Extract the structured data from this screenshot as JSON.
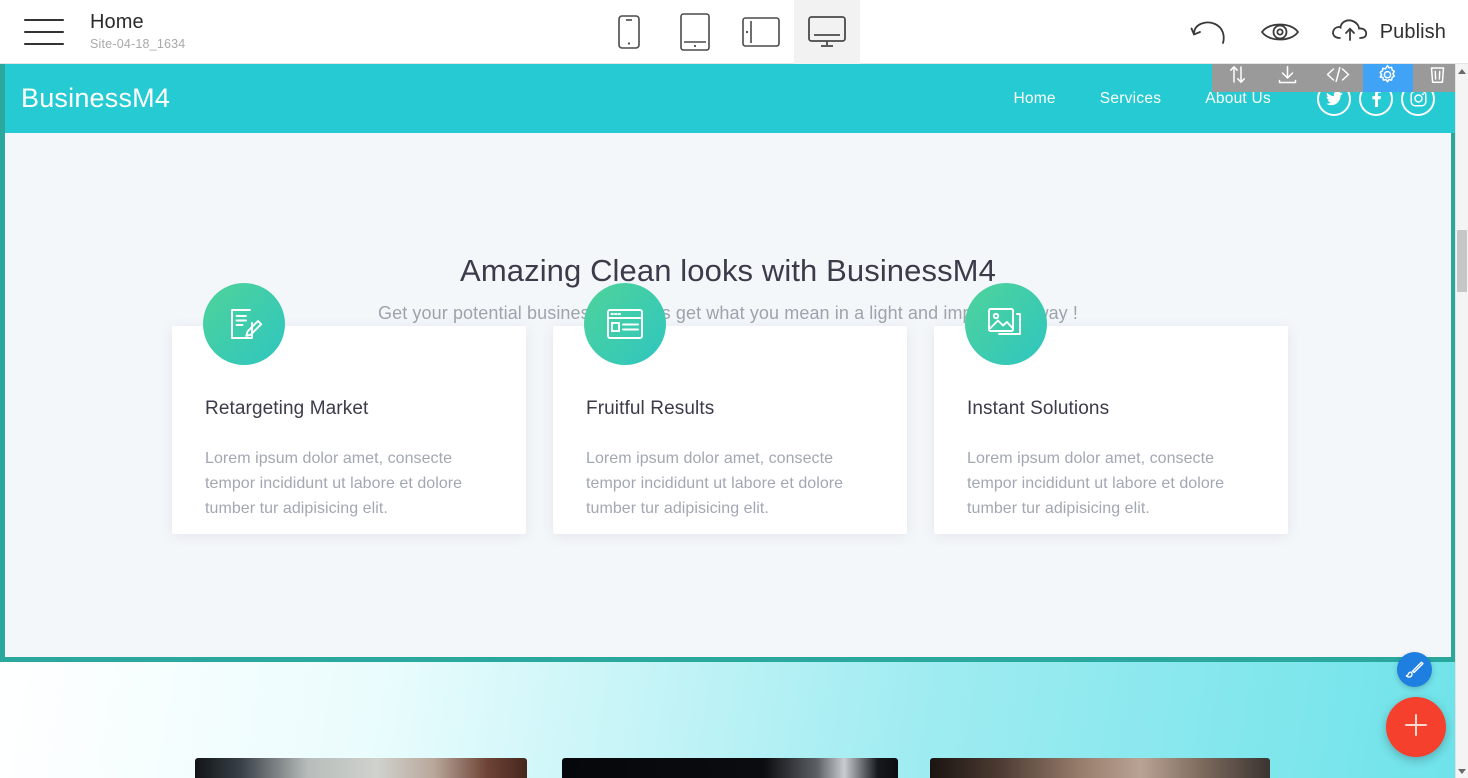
{
  "app_bar": {
    "menu_icon": "hamburger-icon",
    "page_title": "Home",
    "site_id": "Site-04-18_1634",
    "devices": [
      {
        "name": "mobile",
        "icon": "mobile-phone-icon",
        "active": false
      },
      {
        "name": "tablet-portrait",
        "icon": "tablet-portrait-icon",
        "active": false
      },
      {
        "name": "tablet-landscape",
        "icon": "tablet-landscape-icon",
        "active": false
      },
      {
        "name": "desktop",
        "icon": "desktop-monitor-icon",
        "active": true
      }
    ],
    "undo_icon": "undo-arrow-icon",
    "preview_icon": "eye-preview-icon",
    "publish_icon": "cloud-upload-icon",
    "publish_label": "Publish"
  },
  "block_toolbar": {
    "buttons": [
      {
        "name": "move-block",
        "icon": "up-down-arrows-icon",
        "active": false
      },
      {
        "name": "save-block",
        "icon": "download-icon",
        "active": false
      },
      {
        "name": "edit-code",
        "icon": "code-brackets-icon",
        "active": false
      },
      {
        "name": "block-settings",
        "icon": "gear-icon",
        "active": true
      },
      {
        "name": "delete-block",
        "icon": "trash-icon",
        "active": false
      }
    ],
    "active_color": "#41a3f5",
    "bar_color": "#9a9a9a"
  },
  "site": {
    "header": {
      "brand": "BusinessM4",
      "background": "#25cad2",
      "nav": [
        {
          "label": "Home"
        },
        {
          "label": "Services"
        },
        {
          "label": "About Us"
        }
      ],
      "social": [
        {
          "name": "twitter-icon"
        },
        {
          "name": "facebook-icon"
        },
        {
          "name": "instagram-icon"
        }
      ]
    },
    "hero": {
      "title": "Amazing Clean looks with BusinessM4",
      "subtitle": "Get your potential business partners get what you mean in a light and impressive way !",
      "background": "#f4f7fa"
    },
    "cards": [
      {
        "icon": "document-pencil-icon",
        "title": "Retargeting Market",
        "text": "Lorem ipsum dolor amet, consecte tempor incididunt ut labore et dolore tumber tur adipisicing elit."
      },
      {
        "icon": "browser-window-icon",
        "title": "Fruitful Results",
        "text": "Lorem ipsum dolor amet, consecte tempor incididunt ut labore et dolore tumber tur adipisicing elit."
      },
      {
        "icon": "photo-gallery-icon",
        "title": "Instant Solutions",
        "text": "Lorem ipsum dolor amet, consecte tempor incididunt ut labore et dolore tumber tur adipisicing elit."
      }
    ],
    "selection_border_color": "#2aa89d"
  },
  "fabs": {
    "design": {
      "name": "paintbrush-icon",
      "color": "#1f7fe0"
    },
    "add": {
      "name": "plus-icon",
      "color": "#f4402c"
    }
  }
}
